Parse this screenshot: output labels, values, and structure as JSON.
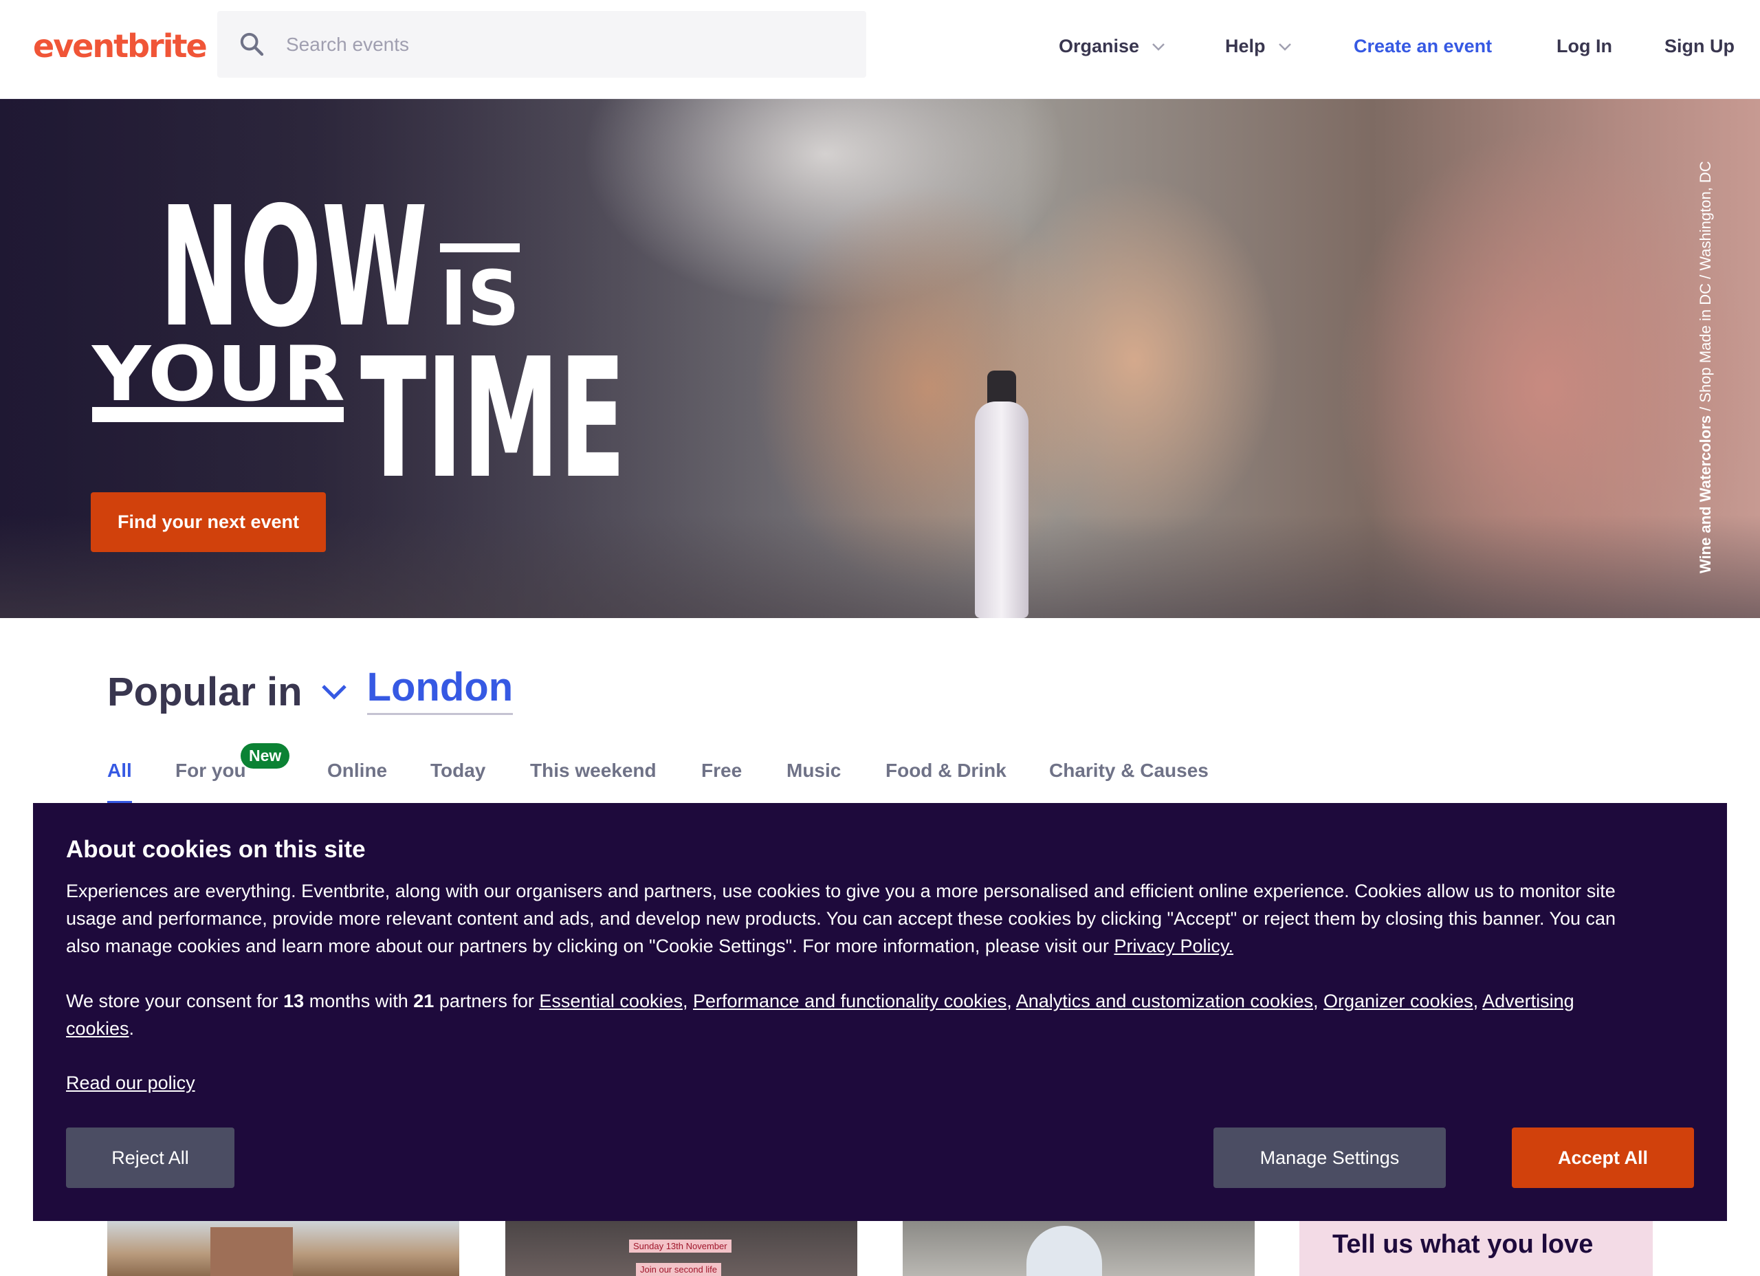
{
  "brand": {
    "logo_text": "eventbrite",
    "accent": "#f05537",
    "primary_blue": "#3659e3",
    "cta_orange": "#d1410c",
    "banner_bg": "#1e0a3c"
  },
  "header": {
    "search_placeholder": "Search events",
    "nav": {
      "organise": "Organise",
      "help": "Help",
      "create_event": "Create an event",
      "log_in": "Log In",
      "sign_up": "Sign Up"
    }
  },
  "hero": {
    "headline": {
      "now": "NOW",
      "is": "IS",
      "your": "YOUR",
      "time": "TIME"
    },
    "cta": "Find your next event",
    "photo_credit_bold": "Wine and Watercolors",
    "photo_credit_rest": " / Shop Made in DC / Washington, DC"
  },
  "popular": {
    "title": "Popular in",
    "location": "London",
    "tabs": [
      {
        "label": "All",
        "active": true
      },
      {
        "label": "For you",
        "badge": "New"
      },
      {
        "label": "Online"
      },
      {
        "label": "Today"
      },
      {
        "label": "This weekend"
      },
      {
        "label": "Free"
      },
      {
        "label": "Music"
      },
      {
        "label": "Food & Drink"
      },
      {
        "label": "Charity & Causes"
      }
    ]
  },
  "cards": {
    "card2_tag1": "Sunday 13th November",
    "card2_tag2": "Join our second life",
    "tell_us": "Tell us what you love"
  },
  "cookie": {
    "title": "About cookies on this site",
    "body": "Experiences are everything. Eventbrite, along with our organisers and partners, use cookies to give you a more personalised and efficient online experience. Cookies allow us to monitor site usage and performance, provide more relevant content and ads, and develop new products. You can accept these cookies by clicking \"Accept\" or reject them by closing this banner. You can also manage cookies and learn more about our partners by clicking on \"Cookie Settings\". For more information, please visit our ",
    "privacy_link": "Privacy Policy.",
    "consent_prefix": "We store your consent for ",
    "months": "13",
    "months_text": " months with ",
    "partners": "21",
    "partners_text": " partners for ",
    "categories": [
      "Essential cookies",
      "Performance and functionality cookies",
      "Analytics and customization cookies",
      "Organizer cookies",
      "Advertising cookies"
    ],
    "read_policy": "Read our policy",
    "buttons": {
      "reject": "Reject All",
      "manage": "Manage Settings",
      "accept": "Accept All"
    }
  }
}
